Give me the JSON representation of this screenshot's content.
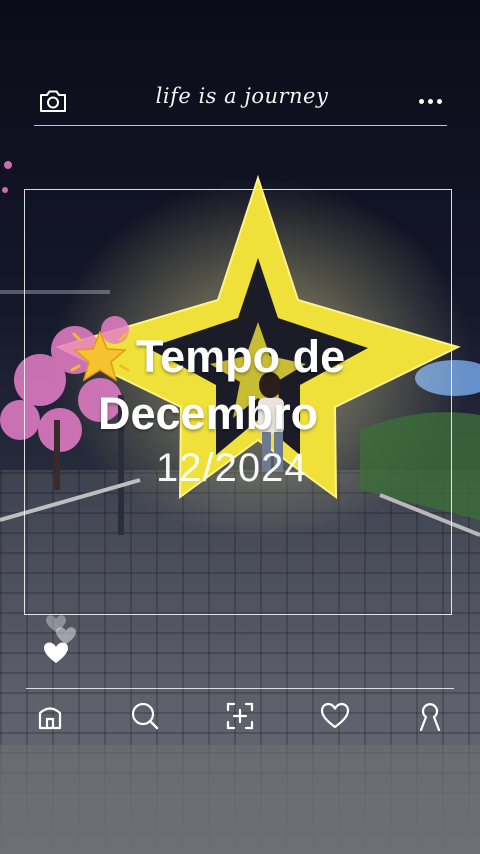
{
  "header": {
    "tagline": "life is a journey",
    "camera_icon": "camera-icon",
    "more_icon": "more-dots-icon"
  },
  "post": {
    "title_line1": "Tempo de",
    "title_line2": "Decembro",
    "title_emoji": "glowing-star-emoji",
    "date": "12/2024"
  },
  "reactions": {
    "icon": "hearts-icon"
  },
  "nav": {
    "items": [
      {
        "icon": "home-icon"
      },
      {
        "icon": "search-icon"
      },
      {
        "icon": "add-post-icon"
      },
      {
        "icon": "heart-icon"
      },
      {
        "icon": "profile-icon"
      }
    ]
  },
  "colors": {
    "star_yellow": "#f2e23a",
    "night_sky": "#0b0c17",
    "blossom_pink": "#e77fc8",
    "emoji_star": "#f7b731"
  }
}
